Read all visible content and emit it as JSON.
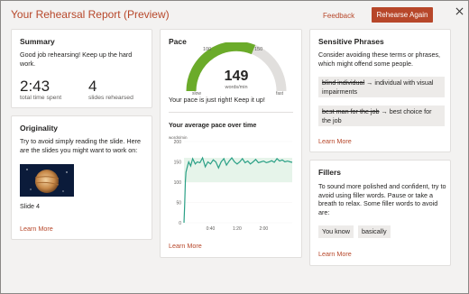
{
  "header": {
    "title": "Your Rehearsal Report (Preview)",
    "feedback_label": "Feedback",
    "rehearse_label": "Rehearse Again"
  },
  "summary": {
    "title": "Summary",
    "message": "Good job rehearsing! Keep up the hard work.",
    "time_value": "2:43",
    "time_label": "total time spent",
    "slides_value": "4",
    "slides_label": "slides rehearsed"
  },
  "originality": {
    "title": "Originality",
    "message": "Try to avoid simply reading the slide. Here are the slides you might want to work on:",
    "slide_label": "Slide 4",
    "learn_more": "Learn More"
  },
  "pace": {
    "title": "Pace",
    "gauge": {
      "min_label": "slow",
      "max_label": "fast",
      "tick_100": "100",
      "tick_150": "150",
      "value": "149",
      "unit": "words/min"
    },
    "message": "Your pace is just right! Keep it up!",
    "chart_title": "Your average pace over time",
    "learn_more": "Learn More"
  },
  "chart_data": {
    "type": "line",
    "title": "Your average pace over time",
    "ylabel": "words/min",
    "ylim": [
      0,
      200
    ],
    "yticks": [
      "0",
      "50",
      "100",
      "150",
      "200"
    ],
    "xticks": [
      "0:40",
      "1:20",
      "2:00"
    ],
    "xtick_values": [
      40,
      80,
      120
    ],
    "xlim": [
      0,
      163
    ],
    "band": [
      100,
      160
    ],
    "x": [
      0,
      1,
      2,
      3,
      5,
      7,
      10,
      13,
      17,
      20,
      24,
      28,
      32,
      36,
      40,
      44,
      48,
      52,
      56,
      60,
      64,
      68,
      72,
      76,
      80,
      84,
      88,
      92,
      96,
      100,
      104,
      108,
      112,
      116,
      120,
      124,
      128,
      132,
      136,
      140,
      144,
      148,
      152,
      156,
      160,
      163
    ],
    "values": [
      0,
      40,
      100,
      125,
      138,
      150,
      140,
      158,
      145,
      150,
      148,
      160,
      138,
      150,
      145,
      155,
      150,
      135,
      150,
      158,
      142,
      152,
      160,
      150,
      145,
      150,
      158,
      148,
      152,
      145,
      150,
      156,
      148,
      150,
      152,
      148,
      150,
      153,
      149,
      158,
      152,
      155,
      150,
      152,
      150,
      149
    ]
  },
  "sensitive": {
    "title": "Sensitive Phrases",
    "message": "Consider avoiding these terms or phrases, which might offend some people.",
    "items": [
      {
        "original": "blind individual",
        "suggestion": "individual with visual impairments"
      },
      {
        "original": "best man for the job",
        "suggestion": "best choice for the job"
      }
    ],
    "learn_more": "Learn More"
  },
  "fillers": {
    "title": "Fillers",
    "message": "To sound more polished and confident, try to avoid using filler words. Pause or take a breath to relax. Some filler words to avoid are:",
    "words": [
      "You know",
      "basically"
    ],
    "learn_more": "Learn More"
  },
  "colors": {
    "accent": "#b7472a",
    "gauge_fill": "#6bab2a",
    "line": "#2aa086",
    "band": "#e6f4ea"
  }
}
